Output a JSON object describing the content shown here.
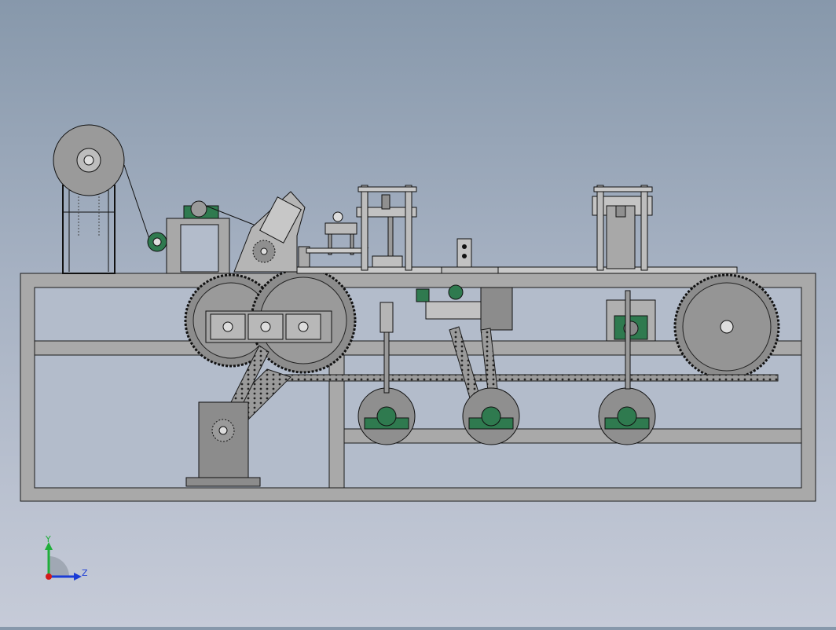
{
  "triad": {
    "y_label": "Y",
    "z_label": "Z",
    "y_color": "#1fae3a",
    "z_color": "#1b3cd6",
    "x_color": "#d41a1a"
  },
  "model": {
    "frame_color": "#a9a9a9",
    "edge_color": "#1a1a1a",
    "bearing_color": "#2f7a4f",
    "gear_color": "#8c8c8c"
  }
}
